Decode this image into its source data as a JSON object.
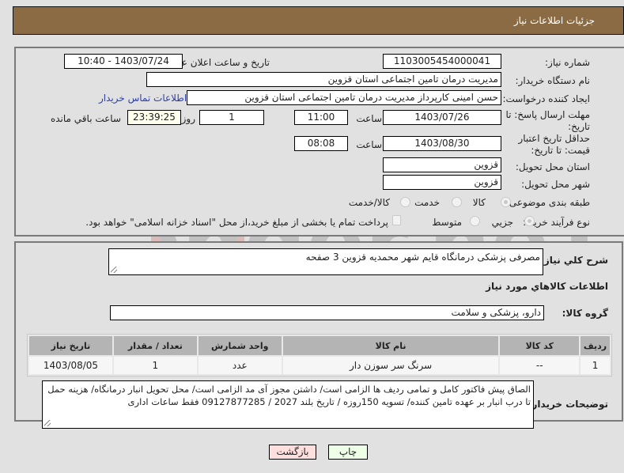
{
  "header": {
    "title": "جزئیات اطلاعات نیاز"
  },
  "details": {
    "need_number_label": "شماره نیاز:",
    "need_number": "1103005454000041",
    "announce_label": "تاریخ و ساعت اعلان عمومی:",
    "announce_value": "1403/07/24 - 10:40",
    "buyer_org_label": "نام دستگاه خریدار:",
    "buyer_org": "مدیریت درمان تامین اجتماعی استان قزوین",
    "creator_label": "ایجاد کننده درخواست:",
    "creator": "حسن امینی کارپرداز مدیریت درمان تامین اجتماعی استان قزوین",
    "contact_link": "اطلاعات تماس خریدار",
    "deadline_label": "مهلت ارسال پاسخ: تا تاریخ:",
    "deadline_date": "1403/07/26",
    "time_label": "ساعت",
    "deadline_time": "11:00",
    "days_value": "1",
    "days_label": "روز و",
    "remaining_time": "23:39:25",
    "remaining_label": "ساعت باقي مانده",
    "validity_label": "حداقل تاریخ اعتبار قیمت: تا تاریخ:",
    "validity_date": "1403/08/30",
    "validity_time": "08:08",
    "province_label": "استان محل تحویل:",
    "province": "قزوین",
    "city_label": "شهر محل تحویل:",
    "city": "قزوین",
    "category_label": "طبقه بندی موضوعی:",
    "category_options": [
      "کالا",
      "خدمت",
      "کالا/خدمت"
    ],
    "category_selected": "کالا",
    "process_label": "نوع فرآیند خرید :",
    "process_options": [
      "جزیي",
      "متوسط"
    ],
    "process_selected": "جزیي",
    "treasury_note": "پرداخت تمام یا بخشی از مبلغ خرید،از محل \"اسناد خزانه اسلامی\" خواهد بود."
  },
  "needs": {
    "summary_label": "شرح کلي نياز:",
    "summary": "مصرفی پزشکی درمانگاه قایم شهر محمدیه قزوین 3 صفحه",
    "items_heading": "اطلاعات کالاهاي مورد نياز",
    "group_label": "گروه کالا:",
    "group_value": "دارو، پزشکی و سلامت",
    "table": {
      "headers": [
        "ردیف",
        "کد کالا",
        "نام کالا",
        "واحد شمارش",
        "تعداد / مقدار",
        "تاریخ نیاز"
      ],
      "rows": [
        [
          "1",
          "--",
          "سرنگ سر سوزن دار",
          "عدد",
          "1",
          "1403/08/05"
        ]
      ]
    },
    "buyer_notes_label": "توضیحات خریدار:",
    "buyer_notes": "الصاق پیش فاکتور کامل و تمامی ردیف ها الزامی است/ داشتن مجوز آی مد الزامی است/ محل تحویل انبار درمانگاه/ هزینه حمل تا درب انبار بر عهده تامین کننده/ تسویه 150روزه / تاریخ بلند 2027 / 09127877285 فقط ساعات اداری"
  },
  "buttons": {
    "print": "چاپ",
    "back": "بازگشت"
  },
  "watermark": {
    "text": "AriaTender.neT"
  },
  "colors": {
    "header_bg": "#8b6b44",
    "link": "#2a3fb0",
    "print_bg": "#eeffe8",
    "back_bg": "#ffdede"
  }
}
